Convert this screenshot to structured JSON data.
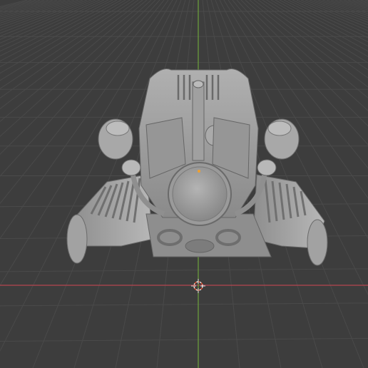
{
  "viewport": {
    "mode": "3d-viewport",
    "background_color": "#3d3d3d",
    "grid_color": "#4a4a4a",
    "x_axis_color": "#b5454f",
    "y_axis_color": "#6ea33c",
    "model_color": "#9c9c9c",
    "model_shadow_color": "#6a6a6a",
    "model_highlight_color": "#c4c4c4",
    "cursor_color": "#e04c2c"
  }
}
